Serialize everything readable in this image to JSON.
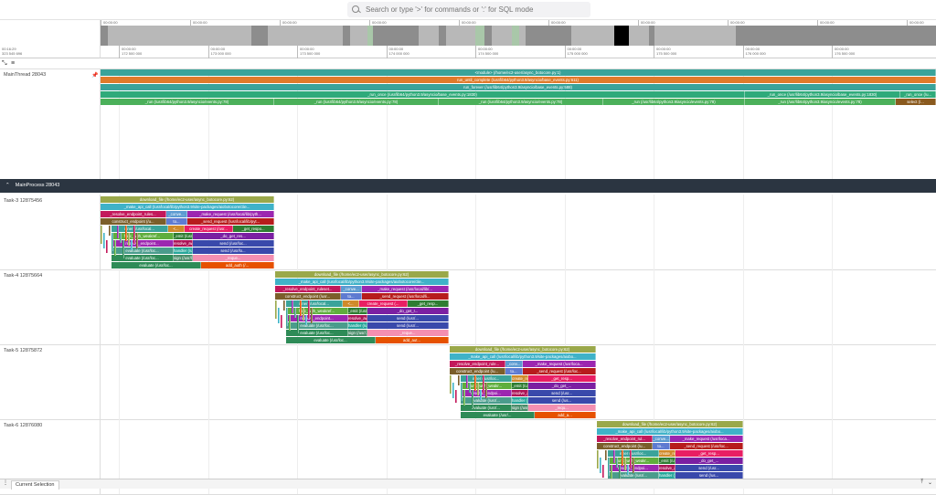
{
  "search": {
    "placeholder": "Search or type '>' for commands or ':' for SQL mode"
  },
  "overview_ticks": [
    "00:00:00",
    "00:00:00",
    "00:00:00",
    "00:00:00",
    "00:00:00",
    "00:00:00",
    "00:00:00",
    "00:00:00",
    "00:00:00",
    "00:00:00"
  ],
  "timeline_info": {
    "time": "00:16:29",
    "sub": "323 545 696"
  },
  "ruler_ticks": [
    {
      "t": "00:00:00",
      "s": "172 500 000"
    },
    {
      "t": "00:00:00",
      "s": "173 000 000"
    },
    {
      "t": "00:00:00",
      "s": "173 500 000"
    },
    {
      "t": "00:00:00",
      "s": "174 000 000"
    },
    {
      "t": "00:00:00",
      "s": "174 500 000"
    },
    {
      "t": "00:00:00",
      "s": "175 000 000"
    },
    {
      "t": "00:00:00",
      "s": "175 500 000"
    },
    {
      "t": "00:00:00",
      "s": "176 000 000"
    },
    {
      "t": "00:00:00",
      "s": "176 500 000"
    }
  ],
  "main_thread": {
    "label": "MainThread 28043",
    "slices": [
      {
        "text": "<module> (/home/ec2-user/async_botocore.py:1)",
        "color": "#3aa39a"
      },
      {
        "text": "run_until_complete (/usr/lib64/python3.9/asyncio/base_events.py:611)",
        "color": "#e07a2a"
      },
      {
        "text": "run_forever (/usr/lib64/python3.9/asyncio/base_events.py:588)",
        "color": "#3aa39a"
      },
      {
        "text": "_run_once (/usr/lib64/python3.9/asyncio/base_events.py:1830)",
        "color": "#2faa7a"
      },
      {
        "text": "_run_once (/usr/lib64/python3.9/asyncio/base_events.py:1830)",
        "color": "#2faa7a"
      },
      {
        "text": "_run_once (/u...",
        "color": "#2faa7a"
      },
      {
        "text": "_run (/usr/lib64/python3.9/asyncio/events.py:78)",
        "color": "#4bb05a"
      },
      {
        "text": "_run (/usr/lib64/python3.9/asyncio/events.py:78)",
        "color": "#4bb05a"
      },
      {
        "text": "_run (/usr/lib64/python3.9/asyncio/events.py:78)",
        "color": "#4bb05a"
      },
      {
        "text": "_run (/usr/lib64/python3.9/asyncio/events.py:78)",
        "color": "#4bb05a"
      },
      {
        "text": "_run (/usr/lib64/python3.9/asyncio/events.py:78)",
        "color": "#4bb05a"
      },
      {
        "text": "select (/...",
        "color": "#8a5a1e"
      }
    ]
  },
  "process": {
    "label": "MainProcess 28043"
  },
  "tasks": [
    {
      "label": "Task-3 12875456",
      "rows": [
        [
          "download_file (/home/ec2-user/async_botocore.py:62)"
        ],
        [
          "_make_api_call (/usr/local/lib/python3.9/site-packages/aiobotocore/clie..."
        ],
        [
          "_resolve_endpoint_rules...",
          "_conve...",
          "_make_request (/usr/local/lib/pyth..."
        ],
        [
          "construct_endpoint (/u...",
          "to...",
          "_send_request (/usr/local/lib/pyt..."
        ],
        [
          "inner (/usr/local...",
          "<...",
          "create_request (/usr...",
          "_get_respo..."
        ],
        [
          "func_with_weakref...",
          "_emit (/usr/lo...",
          "_do_get_res..."
        ],
        [
          "resolve_endpoint...",
          "resolve_awaita...",
          "send (/usr/loc..."
        ],
        [
          "evaluate (/usr/loc...",
          "handler (/usr/...",
          "send (/usr/lo..."
        ],
        [
          "evaluate (/usr/loc...",
          "sign (/usr/loc...",
          "_reque..."
        ],
        [
          "evaluate (/usr/loc...",
          "add_auth (/..."
        ]
      ]
    },
    {
      "label": "Task-4 12875664",
      "rows": [
        [
          "download_file (/home/ec2-user/async_botocore.py:62)"
        ],
        [
          "_make_api_call (/usr/local/lib/python3.9/site-packages/aiobotocore/clie..."
        ],
        [
          "_resolve_endpoint_ruleset...",
          "_conve...",
          "_make_request (/usr/local/lib/..."
        ],
        [
          "construct_endpoint (/usr...",
          "to...",
          "_send_request (/usr/local/li..."
        ],
        [
          "inner (/usr/local...",
          "<...",
          "create_request (...",
          "_get_resp..."
        ],
        [
          "func_with_weakref...",
          "_emit (/usr/lo...",
          "_do_get_r..."
        ],
        [
          "resolve_endpoint...",
          "resolve_awa...",
          "send (/usr/..."
        ],
        [
          "evaluate (/usr/loc...",
          "handler (/usr...",
          "send (/usr/..."
        ],
        [
          "evaluate (/usr/loc...",
          "sign (/usr/...",
          "_reque..."
        ],
        [
          "evaluate (/usr/loc...",
          "add_aut..."
        ]
      ]
    },
    {
      "label": "Task-5 12875872",
      "rows": [
        [
          "download_file (/home/ec2-user/async_botocore.py:62)"
        ],
        [
          "_make_api_call (/usr/local/lib/python3.9/site-packages/aiobo..."
        ],
        [
          "_resolve_endpoint_rule...",
          "_conv...",
          "_make_request (/usr/loca..."
        ],
        [
          "construct_endpoint (/u...",
          "to...",
          "_send_request (/usr/loc..."
        ],
        [
          "inner (/usr/loc...",
          "create_requ...",
          "_get_resp..."
        ],
        [
          "func_with_weakr...",
          "_emit (/usr/...",
          "_do_get_..."
        ],
        [
          "resolve_endpoi...",
          "resolve_aw...",
          "send (/usr..."
        ],
        [
          "evaluate (/usr/...",
          "handler (/u...",
          "send (/us..."
        ],
        [
          "evaluate (/usr/...",
          "sign (/usr/...",
          "_requ..."
        ],
        [
          "evaluate (/usr/...",
          "add_a..."
        ]
      ]
    },
    {
      "label": "Task-6 12876080",
      "rows": [
        [
          "download_file (/home/ec2-user/async_botocore.py:62)"
        ],
        [
          "_make_api_call (/usr/local/lib/python3.9/site-packages/aiobo..."
        ],
        [
          "_resolve_endpoint_rul...",
          "_conve...",
          "_make_request (/usr/loca..."
        ],
        [
          "construct_endpoint (/u...",
          "to...",
          "_send_request (/usr/loc..."
        ],
        [
          "inner (/usr/loc...",
          "create_requ...",
          "_get_resp..."
        ],
        [
          "func_with_weakr...",
          "_emit (/usr/...",
          "_do_get_..."
        ],
        [
          "resolve_endpoi...",
          "resolve_aw...",
          "send (/usr..."
        ],
        [
          "evaluate (/usr/...",
          "handler (/u...",
          "send (/us..."
        ]
      ]
    }
  ],
  "bottom": {
    "tab": "Current Selection"
  },
  "colors": {
    "header_bg": "#2b3541",
    "overview_bg": "#b8b8b8"
  }
}
